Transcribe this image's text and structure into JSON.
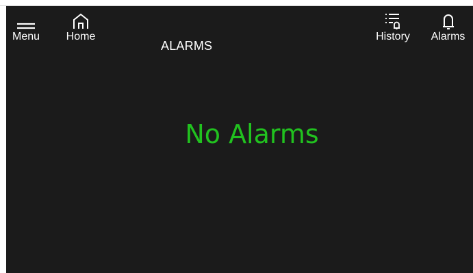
{
  "header": {
    "title": "ALARMS",
    "nav_left": [
      {
        "label": "Menu",
        "icon": "hamburger-menu-icon"
      },
      {
        "label": "Home",
        "icon": "home-icon"
      }
    ],
    "nav_right": [
      {
        "label": "History",
        "icon": "history-list-bell-icon"
      },
      {
        "label": "Alarms",
        "icon": "bell-icon"
      }
    ]
  },
  "main": {
    "status_message": "No Alarms"
  },
  "colors": {
    "background": "#1b1b1b",
    "text": "#ffffff",
    "status_ok": "#21c21f"
  }
}
